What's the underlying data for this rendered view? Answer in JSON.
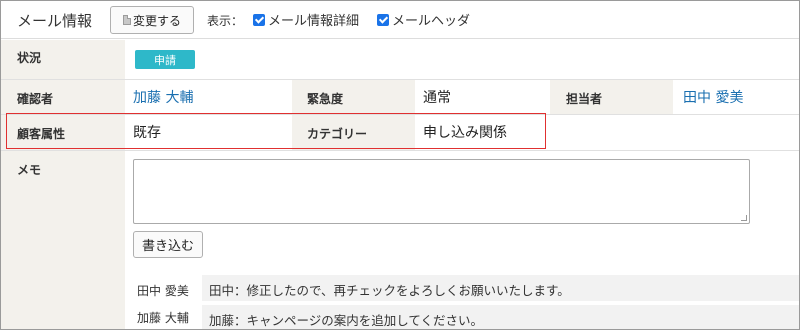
{
  "header": {
    "title": "メール情報",
    "change_button": "変更する",
    "view_label": "表示：",
    "option_detail": "メール情報詳細",
    "option_header": "メールヘッダ"
  },
  "status": {
    "label": "状況",
    "badge": "申請"
  },
  "confirmer": {
    "label": "確認者",
    "value": "加藤 大輔",
    "urgency_label": "緊急度",
    "urgency_value": "通常",
    "assignee_label": "担当者",
    "assignee_value": "田中 愛美"
  },
  "customer": {
    "label": "顧客属性",
    "value": "既存",
    "category_label": "カテゴリー",
    "category_value": "申し込み関係"
  },
  "memo": {
    "label": "メモ",
    "write_button": "書き込む",
    "comments": [
      {
        "author": "田中 愛美",
        "text": "田中：修正したので、再チェックをよろしくお願いいたします。"
      },
      {
        "author": "加藤 大輔",
        "text": "加藤：キャンページの案内を追加してください。"
      }
    ]
  },
  "colors": {
    "badge": "#2eb8c9",
    "link": "#1a6fb0",
    "highlight_border": "#e03030",
    "label_bg": "#f3f1ec"
  }
}
